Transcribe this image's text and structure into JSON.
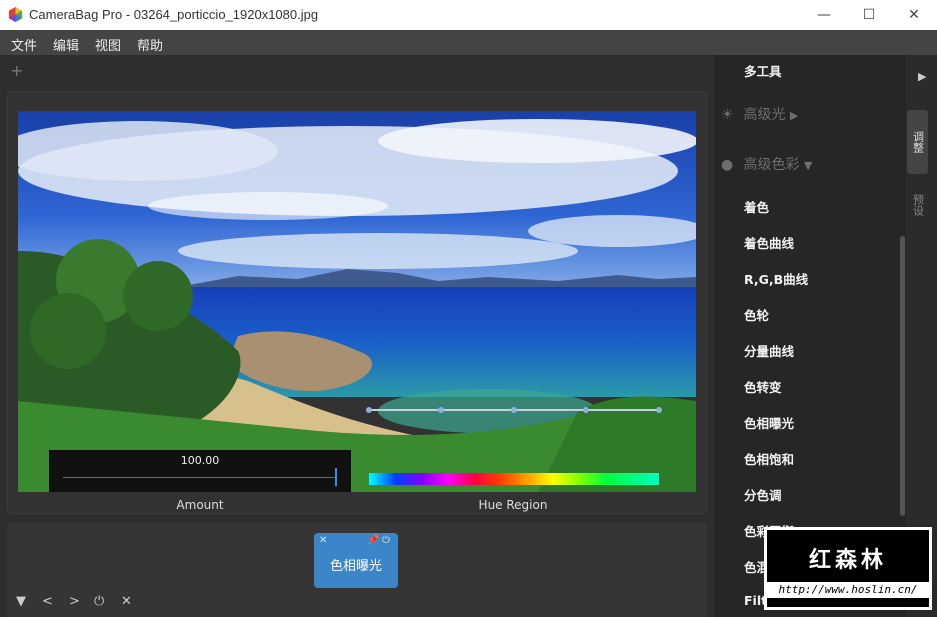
{
  "window": {
    "title": "CameraBag Pro - 03264_porticcio_1920x1080.jpg",
    "minimize_glyph": "—",
    "maximize_glyph": "☐",
    "close_glyph": "✕"
  },
  "menu": {
    "items": [
      "文件",
      "编辑",
      "视图",
      "帮助"
    ]
  },
  "canvas": {
    "add_glyph": "+"
  },
  "adjust": {
    "amount_value": "100.00",
    "amount_fraction": 1.0,
    "amount_label": "Amount",
    "hue_label": "Hue Region"
  },
  "stack": {
    "chip_label": "色相曝光"
  },
  "sidebar": {
    "top_item": "多工具",
    "sections": [
      {
        "label": "高级光",
        "icon": "sun-icon",
        "arrow": "▶"
      },
      {
        "label": "高级色彩",
        "icon": "color-circles-icon",
        "arrow": "▼"
      }
    ],
    "items": [
      "着色",
      "着色曲线",
      "R,G,B曲线",
      "色轮",
      "分量曲线",
      "色转变",
      "色相曝光",
      "色相饱和",
      "分色调",
      "色彩平衡",
      "色混合",
      "Filtered B+W"
    ]
  },
  "right_tabs": [
    "调整",
    "预设"
  ],
  "watermark": {
    "main": "红森林",
    "url": "http://www.hoslin.cn/"
  },
  "colors": {
    "accent": "#3a86c8",
    "panel": "#262626"
  }
}
